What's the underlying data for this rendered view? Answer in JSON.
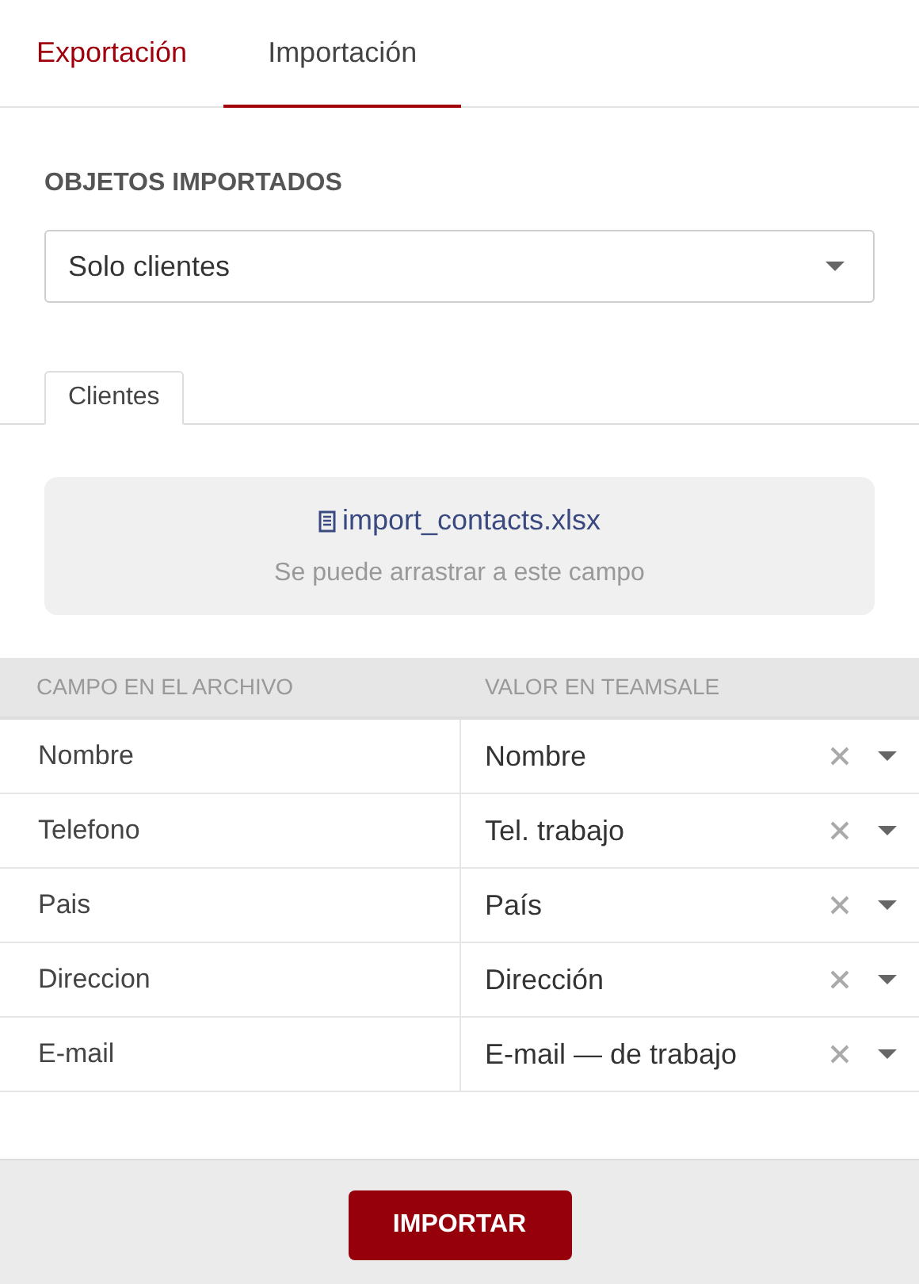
{
  "tabs": [
    {
      "label": "Exportación",
      "selected": false
    },
    {
      "label": "Importación",
      "selected": true
    }
  ],
  "section_label": "OBJETOS IMPORTADOS",
  "object_select": {
    "value": "Solo clientes"
  },
  "subtabs": [
    {
      "label": "Clientes",
      "selected": true
    }
  ],
  "dropzone": {
    "file_name": "import_contacts.xlsx",
    "hint": "Se puede arrastrar a este campo"
  },
  "table": {
    "columns": [
      "CAMPO EN EL ARCHIVO",
      "VALOR EN TEAMSALE"
    ],
    "rows": [
      {
        "file_field": "Nombre",
        "value": "Nombre"
      },
      {
        "file_field": "Telefono",
        "value": "Tel. trabajo"
      },
      {
        "file_field": "Pais",
        "value": "País"
      },
      {
        "file_field": "Direccion",
        "value": "Dirección"
      },
      {
        "file_field": "E-mail",
        "value": "E-mail — de trabajo"
      }
    ]
  },
  "import_button": "IMPORTAR"
}
